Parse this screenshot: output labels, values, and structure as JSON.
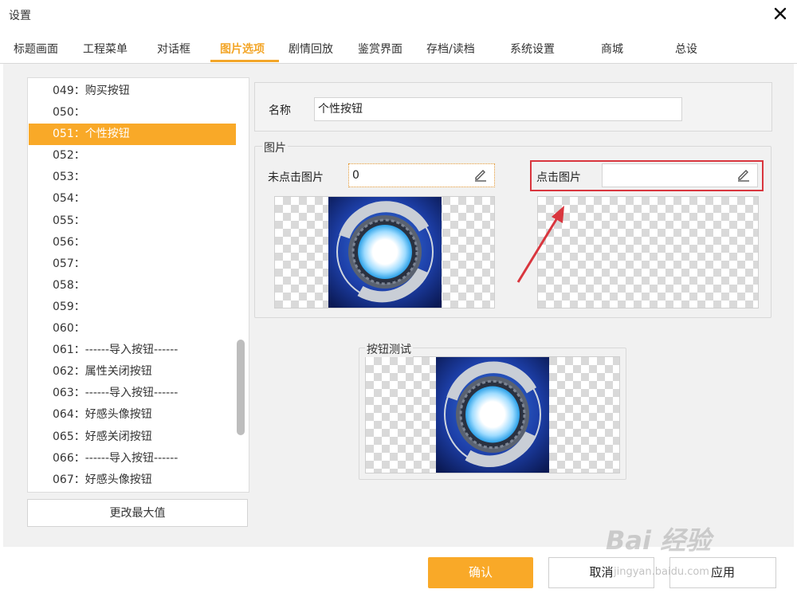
{
  "window": {
    "title": "设置"
  },
  "tabs": [
    {
      "label": "标题画面"
    },
    {
      "label": "工程菜单"
    },
    {
      "label": "对话框"
    },
    {
      "label": "图片选项"
    },
    {
      "label": "剧情回放"
    },
    {
      "label": "鉴赏界面"
    },
    {
      "label": "存档/读档"
    },
    {
      "label": "系统设置"
    },
    {
      "label": "商城"
    },
    {
      "label": "总设"
    }
  ],
  "active_tab": "图片选项",
  "list": {
    "items": [
      {
        "label": "049：购买按钮"
      },
      {
        "label": "050："
      },
      {
        "label": "051：个性按钮"
      },
      {
        "label": "052："
      },
      {
        "label": "053："
      },
      {
        "label": "054："
      },
      {
        "label": "055："
      },
      {
        "label": "056："
      },
      {
        "label": "057："
      },
      {
        "label": "058："
      },
      {
        "label": "059："
      },
      {
        "label": "060："
      },
      {
        "label": "061：------导入按钮------"
      },
      {
        "label": "062：属性关闭按钮"
      },
      {
        "label": "063：------导入按钮------"
      },
      {
        "label": "064：好感头像按钮"
      },
      {
        "label": "065：好感关闭按钮"
      },
      {
        "label": "066：------导入按钮------"
      },
      {
        "label": "067：好感头像按钮"
      }
    ],
    "selected": "051：个性按钮",
    "change_max_button": "更改最大值"
  },
  "name_section": {
    "label": "名称",
    "value": "个性按钮"
  },
  "picture_section": {
    "title": "图片",
    "unclicked_label": "未点击图片",
    "unclicked_value": "0",
    "clicked_label": "点击图片",
    "clicked_value": ""
  },
  "test_section": {
    "title": "按钮测试"
  },
  "footer": {
    "ok": "确认",
    "cancel": "取消",
    "apply": "应用"
  },
  "watermark": {
    "main": "Bai 经验",
    "sub": "jingyan.baidu.com"
  },
  "colors": {
    "accent": "#f9a928",
    "highlight_border": "#d9363e",
    "arrow": "#d9363e"
  }
}
